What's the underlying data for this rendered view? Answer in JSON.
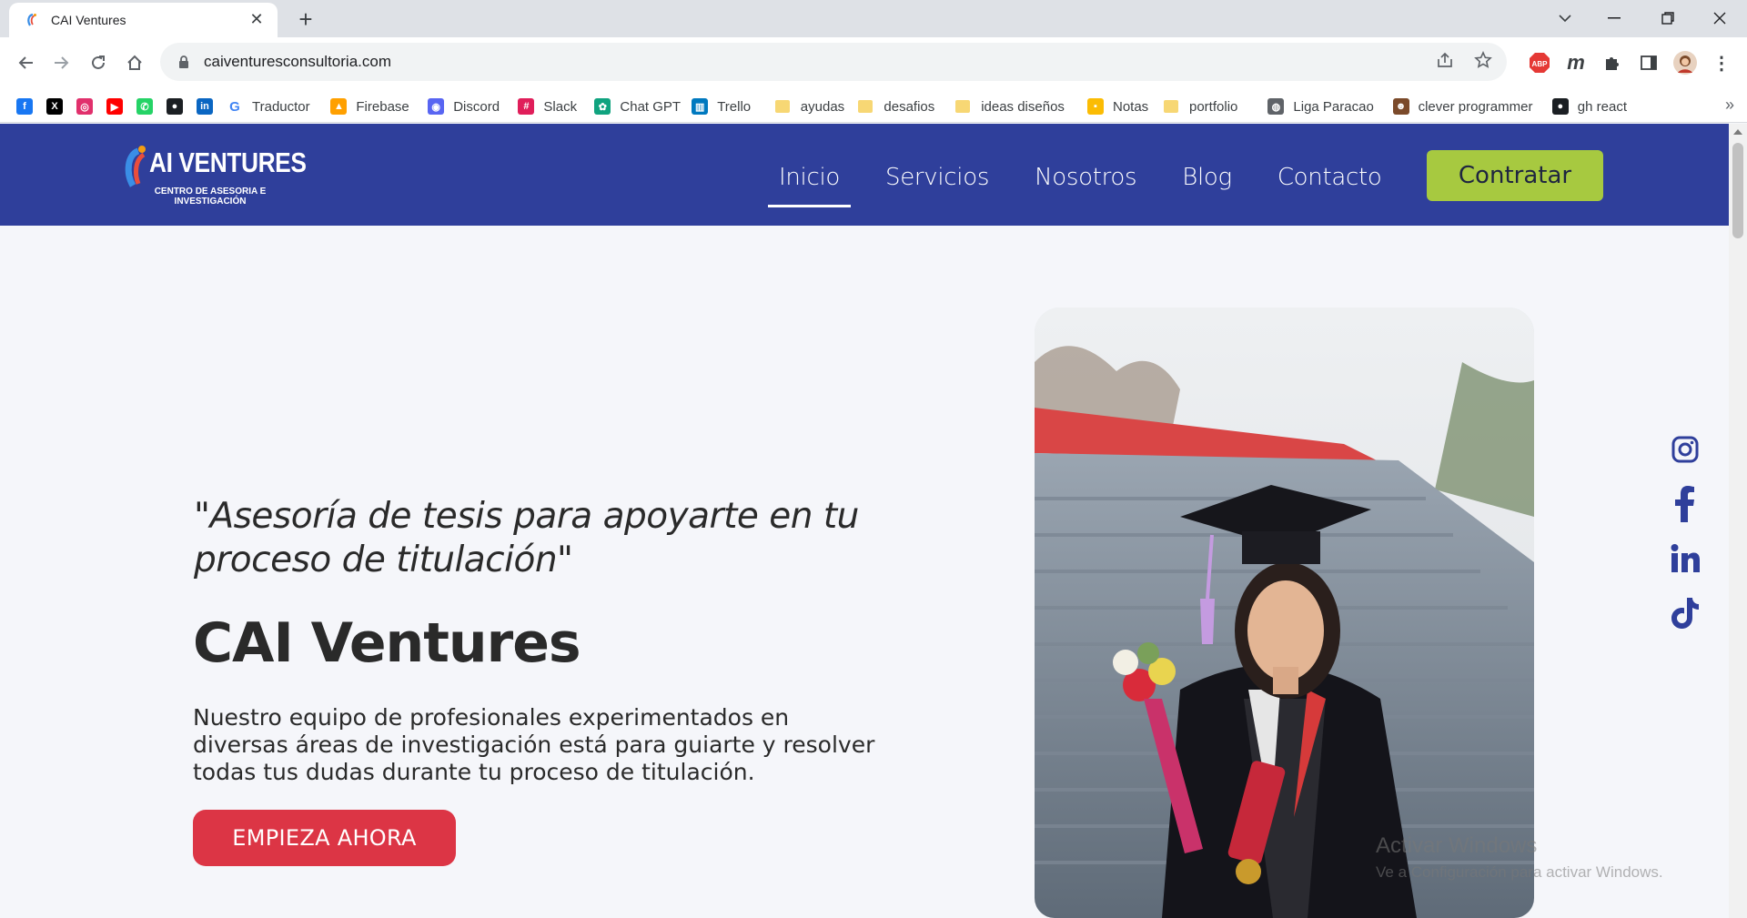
{
  "browser": {
    "tab_title": "CAI Ventures",
    "url": "caiventuresconsultoria.com",
    "bookmarks": [
      {
        "label": "",
        "icon": "facebook-icon",
        "color": "#1877f2"
      },
      {
        "label": "",
        "icon": "x-icon",
        "color": "#000000"
      },
      {
        "label": "",
        "icon": "instagram-icon",
        "color": "#e1306c"
      },
      {
        "label": "",
        "icon": "youtube-icon",
        "color": "#ff0000"
      },
      {
        "label": "",
        "icon": "whatsapp-icon",
        "color": "#25d366"
      },
      {
        "label": "",
        "icon": "github-icon",
        "color": "#1b1f23"
      },
      {
        "label": "",
        "icon": "linkedin-icon",
        "color": "#0a66c2"
      },
      {
        "label": "Traductor",
        "icon": "google-icon",
        "color": "#4285f4"
      },
      {
        "label": "Firebase",
        "icon": "firebase-icon",
        "color": "#ffa000"
      },
      {
        "label": "Discord",
        "icon": "discord-icon",
        "color": "#5865f2"
      },
      {
        "label": "Slack",
        "icon": "slack-icon",
        "color": "#e01e5a"
      },
      {
        "label": "Chat GPT",
        "icon": "chatgpt-icon",
        "color": "#10a37f"
      },
      {
        "label": "Trello",
        "icon": "trello-icon",
        "color": "#0079bf"
      },
      {
        "label": "ayudas",
        "icon": "folder-icon",
        "color": "#f7d774"
      },
      {
        "label": "desafios",
        "icon": "folder-icon",
        "color": "#f7d774"
      },
      {
        "label": "ideas diseños",
        "icon": "folder-icon",
        "color": "#f7d774"
      },
      {
        "label": "Notas",
        "icon": "notes-icon",
        "color": "#fbbc04"
      },
      {
        "label": "portfolio",
        "icon": "folder-icon",
        "color": "#f7d774"
      },
      {
        "label": "Liga Paracao",
        "icon": "globe-icon",
        "color": "#5f6368"
      },
      {
        "label": "clever programmer",
        "icon": "avatar-icon",
        "color": "#7b4a2a"
      },
      {
        "label": "gh react",
        "icon": "github-icon",
        "color": "#1b1f23"
      }
    ]
  },
  "site": {
    "logo_main": "AI VENTURES",
    "logo_sub": "CENTRO DE ASESORIA E INVESTIGACIÓN",
    "nav": [
      "Inicio",
      "Servicios",
      "Nosotros",
      "Blog",
      "Contacto"
    ],
    "nav_active": "Inicio",
    "cta_label": "Contratar",
    "accent_blue": "#2f3f9b",
    "accent_green": "#a7c940",
    "accent_red": "#dc3545"
  },
  "hero": {
    "quote": "\"Asesoría de tesis para apoyarte en tu proceso de titulación\"",
    "title": "CAI Ventures",
    "description": "Nuestro equipo de profesionales experimentados en diversas áreas de investigación está para guiarte y resolver todas tus dudas durante tu proceso de titulación.",
    "button_label": "EMPIEZA AHORA"
  },
  "socials": [
    "instagram-icon",
    "facebook-icon",
    "linkedin-icon",
    "tiktok-icon"
  ],
  "watermark": {
    "line1": "Activar Windows",
    "line2": "Ve a Configuración para activar Windows."
  }
}
